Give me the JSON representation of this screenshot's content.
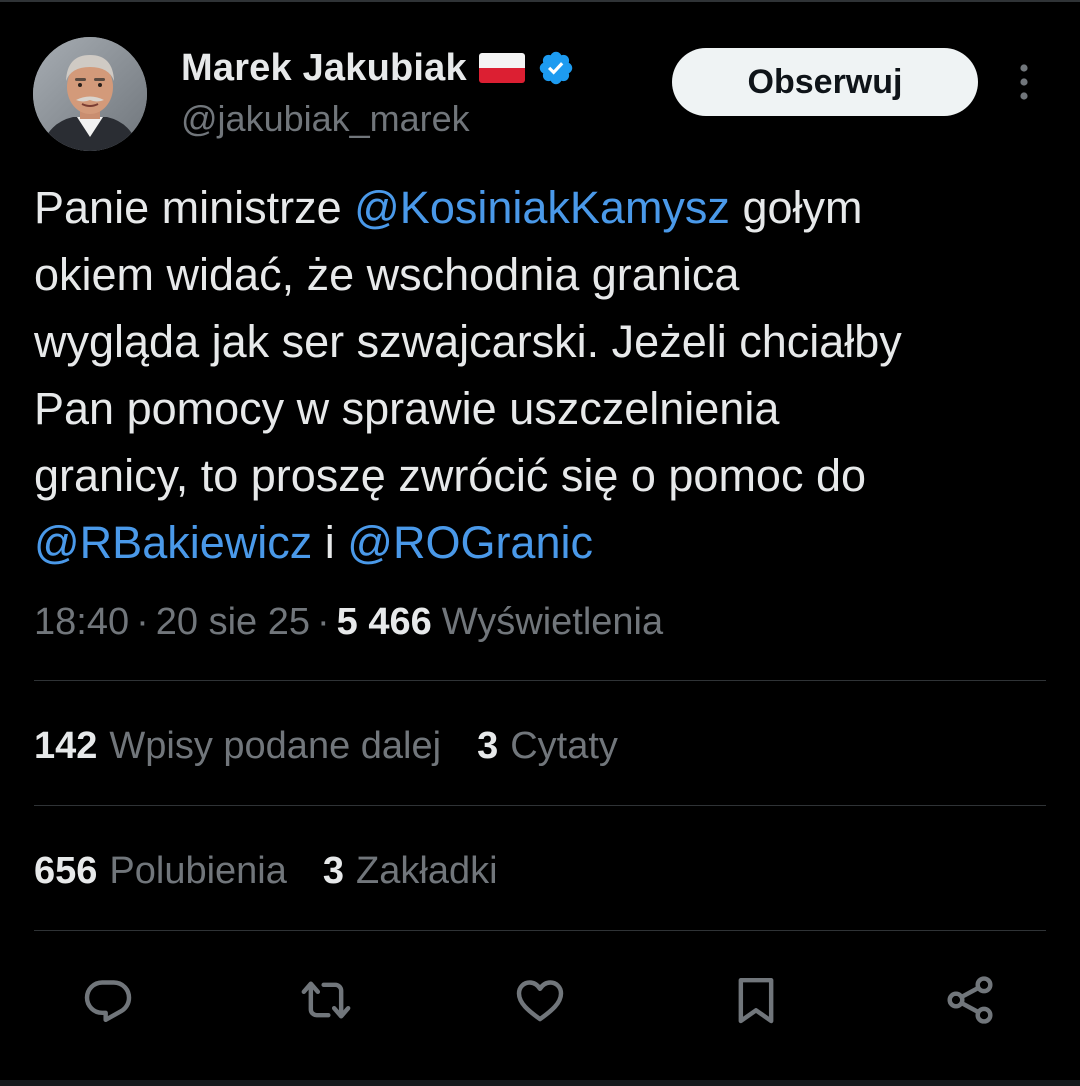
{
  "colors": {
    "background": "#000000",
    "text_primary": "#e7e9ea",
    "text_secondary": "#71767b",
    "mention": "#4a99e9",
    "verified": "#1d9bf0",
    "divider": "#2f3336",
    "follow_button_bg": "#eff3f4"
  },
  "author": {
    "display_name": "Marek Jakubiak",
    "flag_icon": "poland-flag-icon",
    "verified_icon": "verified-badge-icon",
    "handle": "@jakubiak_marek"
  },
  "header": {
    "follow_label": "Obserwuj",
    "more_icon": "more-vertical-icon"
  },
  "tweet": {
    "lines": [
      {
        "pre": "Panie ministrze ",
        "mention": "@KosiniakKamysz",
        "post": " gołym"
      },
      {
        "text": "okiem widać, że wschodnia granica"
      },
      {
        "text": "wygląda jak ser szwajcarski. Jeżeli chciałby"
      },
      {
        "text": "Pan pomocy w sprawie uszczelnienia"
      },
      {
        "text": "granicy, to proszę zwrócić się o pomoc do"
      },
      {
        "mention1": "@RBakiewicz",
        "middle": " i ",
        "mention2": "@ROGranic"
      }
    ]
  },
  "meta": {
    "time": "18:40",
    "separator": "·",
    "date": "20 sie 25",
    "views_count": "5 466",
    "views_label": "Wyświetlenia"
  },
  "stats": {
    "reposts_count": "142",
    "reposts_label": "Wpisy podane dalej",
    "quotes_count": "3",
    "quotes_label": "Cytaty",
    "likes_count": "656",
    "likes_label": "Polubienia",
    "bookmarks_count": "3",
    "bookmarks_label": "Zakładki"
  },
  "actions": [
    {
      "name": "reply",
      "icon": "reply-bubble-icon"
    },
    {
      "name": "repost",
      "icon": "repost-arrows-icon"
    },
    {
      "name": "like",
      "icon": "heart-icon"
    },
    {
      "name": "bookmark",
      "icon": "bookmark-icon"
    },
    {
      "name": "share",
      "icon": "share-icon"
    }
  ]
}
